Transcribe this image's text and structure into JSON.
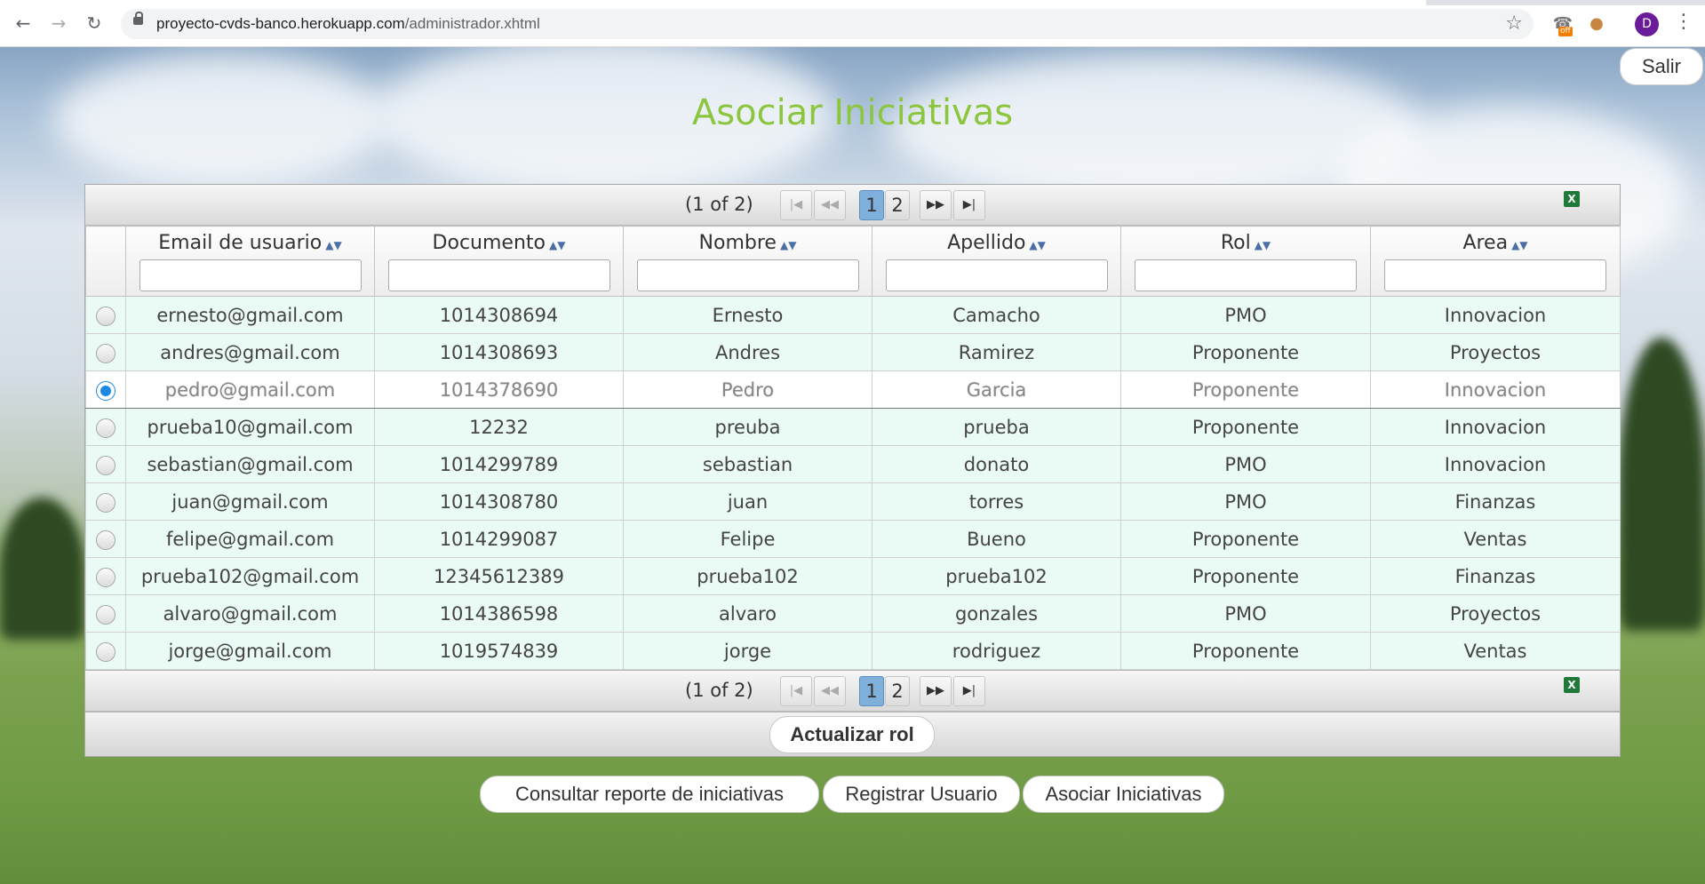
{
  "browser": {
    "url_host": "proyecto-cvds-banco.herokuapp.com",
    "url_path": "/administrador.xhtml",
    "profile_initial": "D",
    "extension_badge": "off"
  },
  "header": {
    "logout_label": "Salir"
  },
  "page": {
    "title": "Asociar Iniciativas"
  },
  "table": {
    "page_report": "(1 of 2)",
    "pages": [
      "1",
      "2"
    ],
    "current_page": "1",
    "columns": [
      "Email de usuario",
      "Documento",
      "Nombre",
      "Apellido",
      "Rol",
      "Area"
    ],
    "rows": [
      {
        "email": "ernesto@gmail.com",
        "documento": "1014308694",
        "nombre": "Ernesto",
        "apellido": "Camacho",
        "rol": "PMO",
        "area": "Innovacion"
      },
      {
        "email": "andres@gmail.com",
        "documento": "1014308693",
        "nombre": "Andres",
        "apellido": "Ramirez",
        "rol": "Proponente",
        "area": "Proyectos"
      },
      {
        "email": "pedro@gmail.com",
        "documento": "1014378690",
        "nombre": "Pedro",
        "apellido": "Garcia",
        "rol": "Proponente",
        "area": "Innovacion"
      },
      {
        "email": "prueba10@gmail.com",
        "documento": "12232",
        "nombre": "preuba",
        "apellido": "prueba",
        "rol": "Proponente",
        "area": "Innovacion"
      },
      {
        "email": "sebastian@gmail.com",
        "documento": "1014299789",
        "nombre": "sebastian",
        "apellido": "donato",
        "rol": "PMO",
        "area": "Innovacion"
      },
      {
        "email": "juan@gmail.com",
        "documento": "1014308780",
        "nombre": "juan",
        "apellido": "torres",
        "rol": "PMO",
        "area": "Finanzas"
      },
      {
        "email": "felipe@gmail.com",
        "documento": "1014299087",
        "nombre": "Felipe",
        "apellido": "Bueno",
        "rol": "Proponente",
        "area": "Ventas"
      },
      {
        "email": "prueba102@gmail.com",
        "documento": "12345612389",
        "nombre": "prueba102",
        "apellido": "prueba102",
        "rol": "Proponente",
        "area": "Finanzas"
      },
      {
        "email": "alvaro@gmail.com",
        "documento": "1014386598",
        "nombre": "alvaro",
        "apellido": "gonzales",
        "rol": "PMO",
        "area": "Proyectos"
      },
      {
        "email": "jorge@gmail.com",
        "documento": "1019574839",
        "nombre": "jorge",
        "apellido": "rodriguez",
        "rol": "Proponente",
        "area": "Ventas"
      }
    ],
    "selected_row": 2,
    "update_button": "Actualizar rol"
  },
  "actions": {
    "report_button": "Consultar reporte de iniciativas",
    "register_button": "Registrar Usuario",
    "associate_button": "Asociar Iniciativas"
  }
}
